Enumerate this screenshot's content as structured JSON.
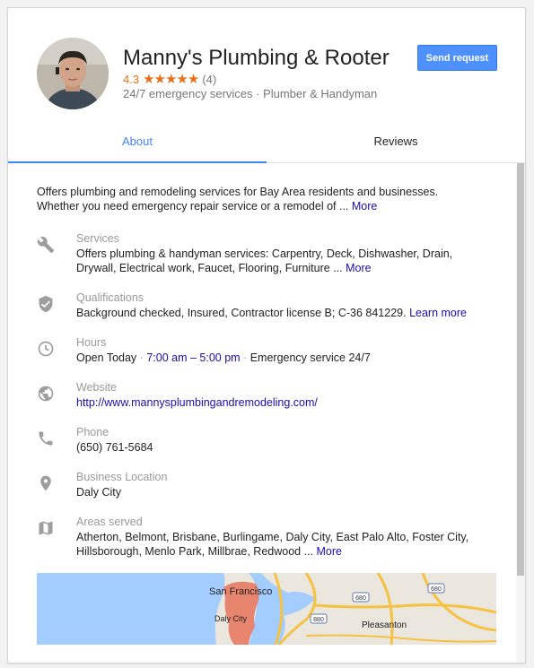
{
  "business": {
    "name": "Manny's Plumbing & Rooter",
    "rating": "4.3",
    "stars": "★★★★★",
    "review_count": "(4)",
    "subtitle": "24/7 emergency services · Plumber & Handyman",
    "send_request_label": "Send request"
  },
  "tabs": [
    {
      "label": "About",
      "active": true
    },
    {
      "label": "Reviews",
      "active": false
    }
  ],
  "about": {
    "description": "Offers plumbing and remodeling services for Bay Area residents and businesses. Whether you need emergency repair service or a remodel of",
    "ellipsis": "...",
    "more": "More"
  },
  "details": {
    "services": {
      "label": "Services",
      "value": "Offers plumbing & handyman services: Carpentry, Deck, Dishwasher, Drain, Drywall, Electrical work, Faucet, Flooring, Furniture",
      "ellipsis": "...",
      "more": "More",
      "icon": "wrench-icon"
    },
    "qualifications": {
      "label": "Qualifications",
      "value": "Background checked, Insured, Contractor license B; C-36 841229.",
      "learn_more": "Learn more",
      "icon": "shield-check-icon"
    },
    "hours": {
      "label": "Hours",
      "open_today": "Open Today",
      "sep1": "·",
      "time_range": "7:00 am – 5:00 pm",
      "sep2": "·",
      "emergency": "Emergency service 24/7",
      "icon": "clock-icon"
    },
    "website": {
      "label": "Website",
      "value": "http://www.mannysplumbingandremodeling.com/",
      "icon": "globe-icon"
    },
    "phone": {
      "label": "Phone",
      "value": "(650) 761-5684",
      "icon": "phone-icon"
    },
    "location": {
      "label": "Business Location",
      "value": "Daly City",
      "icon": "map-pin-icon"
    },
    "areas": {
      "label": "Areas served",
      "value": "Atherton, Belmont, Brisbane, Burlingame, Daly City, East Palo Alto, Foster City, Hillsborough, Menlo Park, Millbrae, Redwood",
      "ellipsis": "...",
      "more": "More",
      "icon": "map-icon"
    }
  },
  "map": {
    "labels": {
      "san_francisco": "San Francisco",
      "daly_city": "Daly City",
      "pleasanton": "Pleasanton",
      "hw_680_a": "680",
      "hw_680_b": "680",
      "hw_880": "880"
    }
  },
  "colors": {
    "accent": "#4285f4",
    "button": "#4d90fe",
    "rating": "#e7711b",
    "link": "#1a0dab",
    "service_area": "#e8735a"
  }
}
